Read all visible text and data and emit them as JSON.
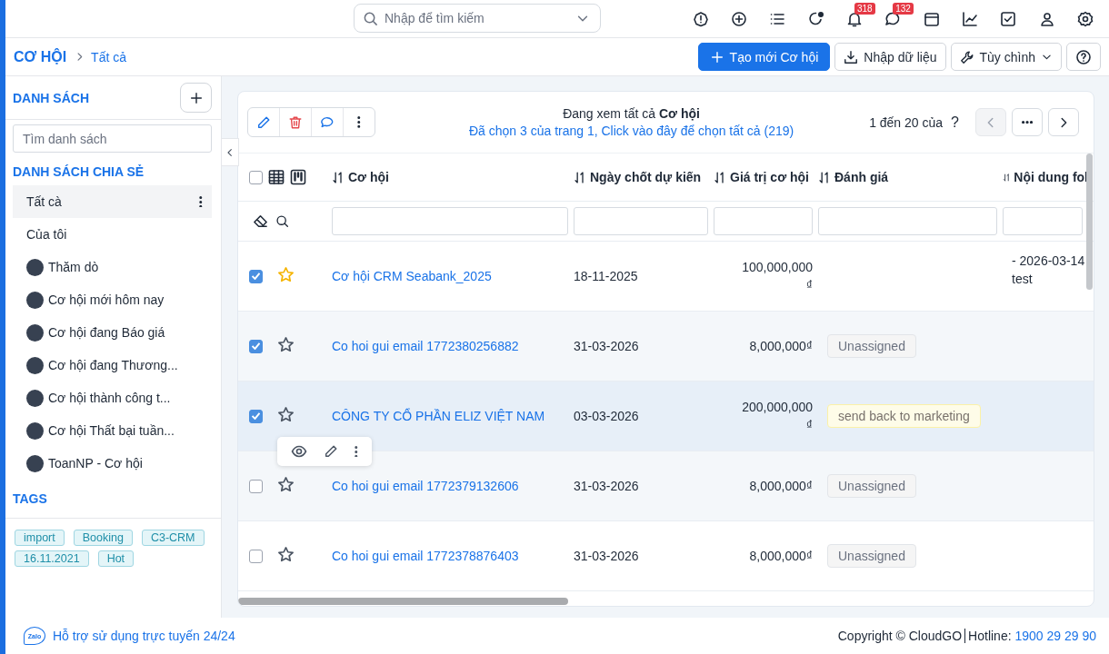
{
  "topbar": {
    "search": {
      "placeholder": "Nhập để tìm kiếm"
    },
    "icons": [
      {
        "kind": "alert"
      },
      {
        "kind": "add"
      },
      {
        "kind": "list"
      },
      {
        "kind": "status"
      },
      {
        "kind": "bell",
        "badge": "318"
      },
      {
        "kind": "chat",
        "badge": "132"
      },
      {
        "kind": "calendar"
      },
      {
        "kind": "chart"
      },
      {
        "kind": "task"
      },
      {
        "kind": "user"
      },
      {
        "kind": "settings"
      }
    ]
  },
  "breadcrumb": {
    "module": "CƠ HỘI",
    "current": "Tất cả"
  },
  "actions": [
    {
      "kind": "primary",
      "label": "Tạo mới Cơ hội"
    },
    {
      "kind": "import",
      "label": "Nhập dữ liệu"
    },
    {
      "kind": "customize",
      "label": "Tùy chình"
    },
    {
      "kind": "help"
    }
  ],
  "sidebar": {
    "title": "DANH SÁCH",
    "search": {
      "placeholder": "Tìm danh sách"
    },
    "shared_title": "DANH SÁCH CHIA SẺ",
    "lists": [
      {
        "label": "Tất cà",
        "kind": "plain",
        "selected": true
      },
      {
        "label": "Của tôi",
        "kind": "plain",
        "selected": false
      },
      {
        "label": "Thăm dò",
        "kind": "user",
        "selected": false
      },
      {
        "label": "Cơ hội mới hôm nay",
        "kind": "user",
        "selected": false
      },
      {
        "label": "Cơ hội đang Báo giá",
        "kind": "user",
        "selected": false
      },
      {
        "label": "Cơ hội đang Thương...",
        "kind": "user",
        "selected": false
      },
      {
        "label": "Cơ hội thành công t...",
        "kind": "user",
        "selected": false
      },
      {
        "label": "Cơ hội Thất bại tuần...",
        "kind": "user",
        "selected": false
      },
      {
        "label": "ToanNP - Cơ hội",
        "kind": "user",
        "selected": false
      }
    ],
    "tags_title": "TAGS",
    "tags": [
      "import",
      "Booking",
      "C3-CRM",
      "16.11.2021",
      "Hot"
    ]
  },
  "list": {
    "viewing": "Đang xem tất cả **Cơ hội**",
    "selection": "Đã chọn 3 của trang 1, Click vào đây để chọn tất cả (219)",
    "pager": "1 đến 20 của",
    "pager_unknown": "?"
  },
  "table": {
    "select_all_checked": false,
    "columns": [
      "Cơ hội",
      "Ngày chốt dự kiến",
      "Giá trị cơ hội",
      "Đánh giá",
      "Nội dung fol"
    ],
    "rows": [
      {
        "checked": true,
        "starred": true,
        "highlighted": false,
        "name": "Cơ hội CRM Seabank_2025",
        "date": "18-11-2025",
        "value": "100,000,000₫",
        "notes": [
          "- 2026-03-14",
          "test"
        ]
      },
      {
        "checked": true,
        "starred": false,
        "highlighted": false,
        "name": "Co hoi gui email 1772380256882",
        "date": "31-03-2026",
        "value": "8,000,000₫",
        "rating": {
          "label": "Unassigned",
          "kind": "neutral"
        }
      },
      {
        "checked": true,
        "starred": false,
        "highlighted": true,
        "name": "CÔNG TY CỔ PHẦN ELIZ VIỆT NAM",
        "date": "03-03-2026",
        "value": "200,000,000₫",
        "rating": {
          "label": "send back to marketing",
          "kind": "warning"
        }
      },
      {
        "checked": false,
        "starred": false,
        "highlighted": false,
        "name": "Co hoi gui email 1772379132606",
        "date": "31-03-2026",
        "value": "8,000,000₫",
        "rating": {
          "label": "Unassigned",
          "kind": "neutral"
        }
      },
      {
        "checked": false,
        "starred": false,
        "highlighted": false,
        "name": "Co hoi gui email 1772378876403",
        "date": "31-03-2026",
        "value": "8,000,000₫",
        "rating": {
          "label": "Unassigned",
          "kind": "neutral"
        }
      }
    ]
  },
  "footer": {
    "logo": "Zalo",
    "support": "Hỗ trợ sử dụng trực tuyến 24/24",
    "copyright": "Copyright © CloudGO",
    "hotline_label": "Hotline: ",
    "hotline": "1900 29 29 90"
  }
}
